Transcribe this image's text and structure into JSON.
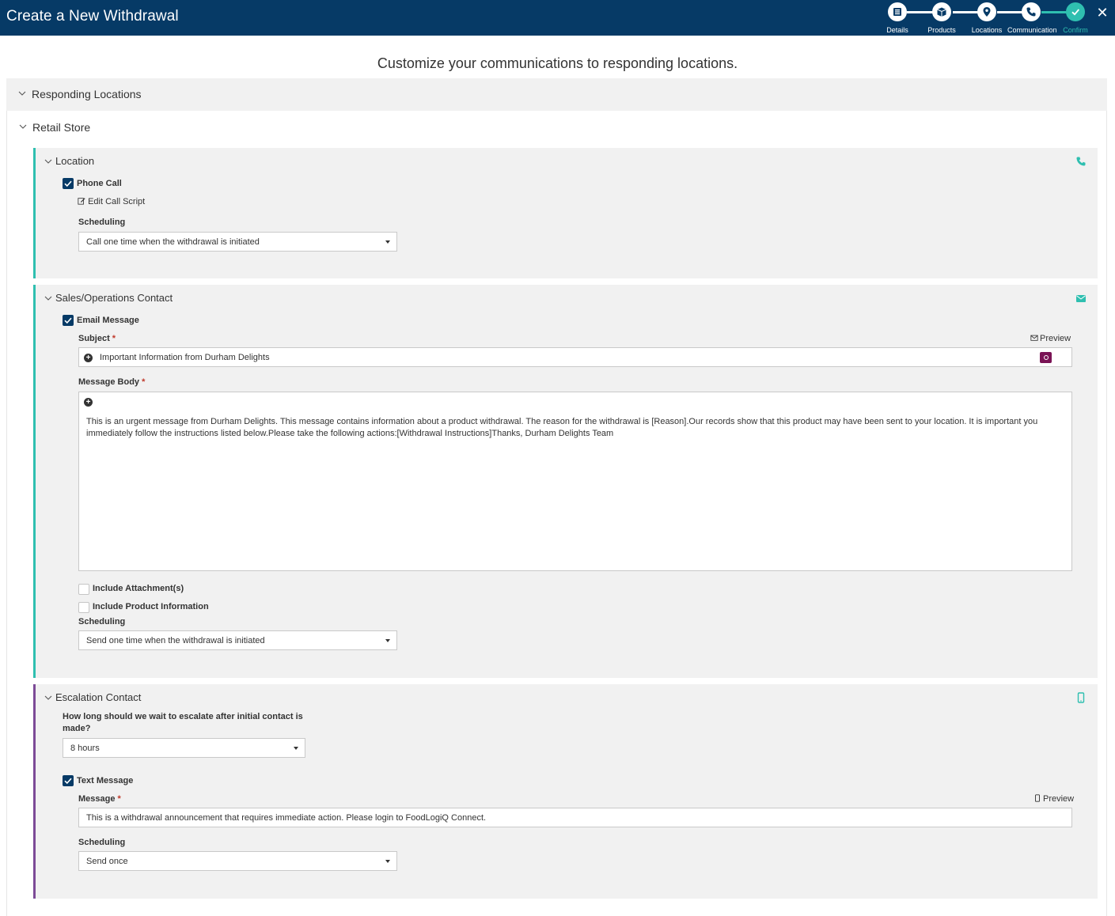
{
  "header": {
    "title": "Create a New Withdrawal",
    "steps": [
      {
        "label": "Details",
        "icon": "list-icon"
      },
      {
        "label": "Products",
        "icon": "box-icon"
      },
      {
        "label": "Locations",
        "icon": "map-pin-icon"
      },
      {
        "label": "Communication",
        "icon": "phone-icon"
      },
      {
        "label": "Confirm",
        "icon": "check-icon"
      }
    ],
    "current_step": "Confirm",
    "close_icon": "close-icon"
  },
  "page": {
    "heading": "Customize your communications to responding locations."
  },
  "responding_locations": {
    "label": "Responding Locations"
  },
  "retail_store": {
    "label": "Retail Store"
  },
  "location": {
    "title": "Location",
    "icon": "phone-icon",
    "phone_call": {
      "label": "Phone Call",
      "checked": true
    },
    "edit_call_script": "Edit Call Script",
    "scheduling_label": "Scheduling",
    "scheduling_value": "Call one time when the withdrawal is initiated"
  },
  "sales_contact": {
    "title": "Sales/Operations Contact",
    "icon": "envelope-icon",
    "email_message": {
      "label": "Email Message",
      "checked": true
    },
    "subject_label": "Subject",
    "required_mark": "*",
    "preview_label": "Preview",
    "subject_value": "Important Information from Durham Delights",
    "message_body_label": "Message Body",
    "message_body_value": "This is an urgent message from Durham Delights. This message contains information about a product withdrawal. The reason for the withdrawal is [Reason].Our records show that this product may have been sent to your location. It is important you immediately follow the instructions listed below.Please take the following actions:[Withdrawal Instructions]Thanks, Durham Delights Team",
    "include_attachments": {
      "label": "Include Attachment(s)",
      "checked": false
    },
    "include_product_info": {
      "label": "Include Product Information",
      "checked": false
    },
    "scheduling_label": "Scheduling",
    "scheduling_value": "Send one time when the withdrawal is initiated"
  },
  "escalation": {
    "title": "Escalation Contact",
    "icon": "mobile-icon",
    "wait_question": "How long should we wait to escalate after initial contact is made?",
    "wait_value": "8 hours",
    "text_message": {
      "label": "Text Message",
      "checked": true
    },
    "message_label": "Message",
    "required_mark": "*",
    "preview_label": "Preview",
    "message_value": "This is a withdrawal announcement that requires immediate action. Please login to FoodLogiQ Connect.",
    "scheduling_label": "Scheduling",
    "scheduling_value": "Send once"
  },
  "colors": {
    "header_bg": "#063a66",
    "accent_teal": "#2fbfb0",
    "accent_purple": "#7d4b97",
    "panel_bg": "#f1f1f1",
    "tag_button": "#7a1355"
  }
}
